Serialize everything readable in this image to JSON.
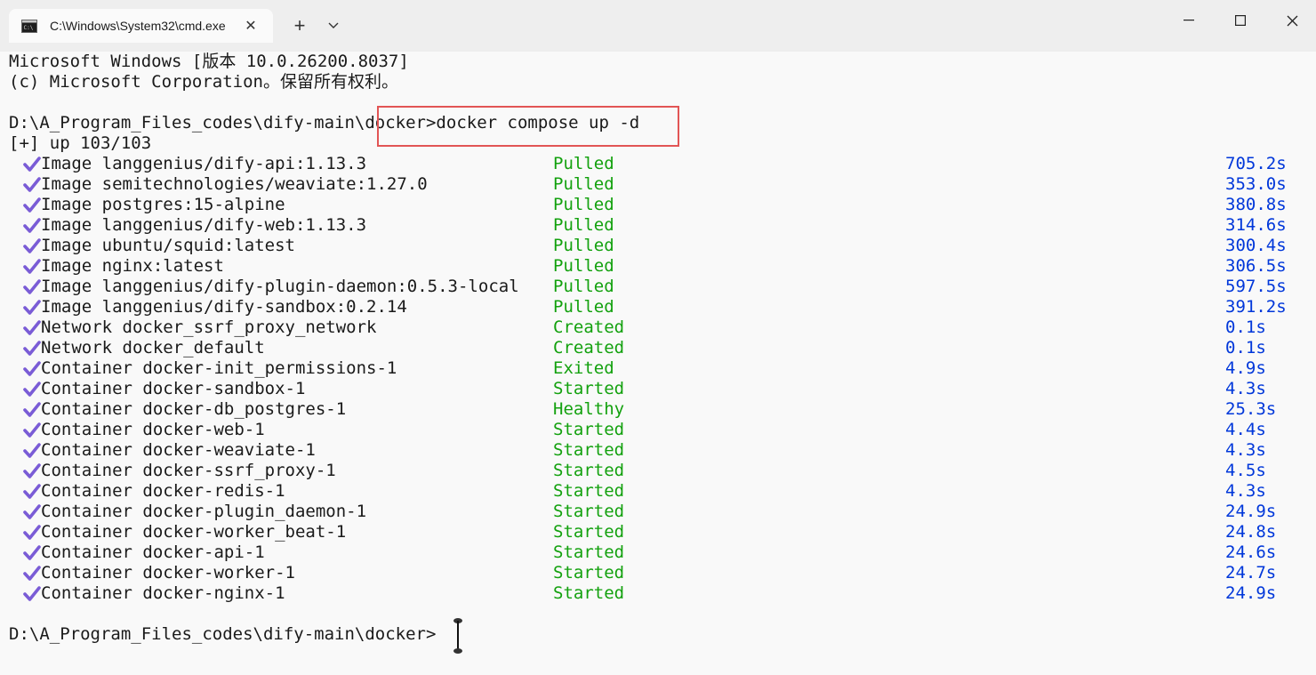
{
  "window": {
    "tab_title": "C:\\Windows\\System32\\cmd.exe",
    "tab_close": "✕",
    "new_tab": "+",
    "dropdown": "⌄",
    "minimize": "—",
    "maximize": "☐",
    "close": "✕"
  },
  "terminal": {
    "header1": "Microsoft Windows [版本 10.0.26200.8037]",
    "header2": "(c) Microsoft Corporation。保留所有权利。",
    "prompt_cmd": "D:\\A_Program_Files_codes\\dify-main\\docker>docker compose up -d",
    "progress": "[+] up 103/103",
    "rows": [
      {
        "name": "Image langgenius/dify-api:1.13.3",
        "status": "Pulled",
        "duration": "705.2s"
      },
      {
        "name": "Image semitechnologies/weaviate:1.27.0",
        "status": "Pulled",
        "duration": "353.0s"
      },
      {
        "name": "Image postgres:15-alpine",
        "status": "Pulled",
        "duration": "380.8s"
      },
      {
        "name": "Image langgenius/dify-web:1.13.3",
        "status": "Pulled",
        "duration": "314.6s"
      },
      {
        "name": "Image ubuntu/squid:latest",
        "status": "Pulled",
        "duration": "300.4s"
      },
      {
        "name": "Image nginx:latest",
        "status": "Pulled",
        "duration": "306.5s"
      },
      {
        "name": "Image langgenius/dify-plugin-daemon:0.5.3-local",
        "status": "Pulled",
        "duration": "597.5s"
      },
      {
        "name": "Image langgenius/dify-sandbox:0.2.14",
        "status": "Pulled",
        "duration": "391.2s"
      },
      {
        "name": "Network docker_ssrf_proxy_network",
        "status": "Created",
        "duration": "0.1s"
      },
      {
        "name": "Network docker_default",
        "status": "Created",
        "duration": "0.1s"
      },
      {
        "name": "Container docker-init_permissions-1",
        "status": "Exited",
        "duration": "4.9s"
      },
      {
        "name": "Container docker-sandbox-1",
        "status": "Started",
        "duration": "4.3s"
      },
      {
        "name": "Container docker-db_postgres-1",
        "status": "Healthy",
        "duration": "25.3s"
      },
      {
        "name": "Container docker-web-1",
        "status": "Started",
        "duration": "4.4s"
      },
      {
        "name": "Container docker-weaviate-1",
        "status": "Started",
        "duration": "4.3s"
      },
      {
        "name": "Container docker-ssrf_proxy-1",
        "status": "Started",
        "duration": "4.5s"
      },
      {
        "name": "Container docker-redis-1",
        "status": "Started",
        "duration": "4.3s"
      },
      {
        "name": "Container docker-plugin_daemon-1",
        "status": "Started",
        "duration": "24.9s"
      },
      {
        "name": "Container docker-worker_beat-1",
        "status": "Started",
        "duration": "24.8s"
      },
      {
        "name": "Container docker-api-1",
        "status": "Started",
        "duration": "24.6s"
      },
      {
        "name": "Container docker-worker-1",
        "status": "Started",
        "duration": "24.7s"
      },
      {
        "name": "Container docker-nginx-1",
        "status": "Started",
        "duration": "24.9s"
      }
    ],
    "final_prompt": "D:\\A_Program_Files_codes\\dify-main\\docker>"
  },
  "colors": {
    "check": "#7a5cd6",
    "status_green": "#13a10e",
    "duration_blue": "#0037da",
    "highlight_red": "#e25555"
  }
}
